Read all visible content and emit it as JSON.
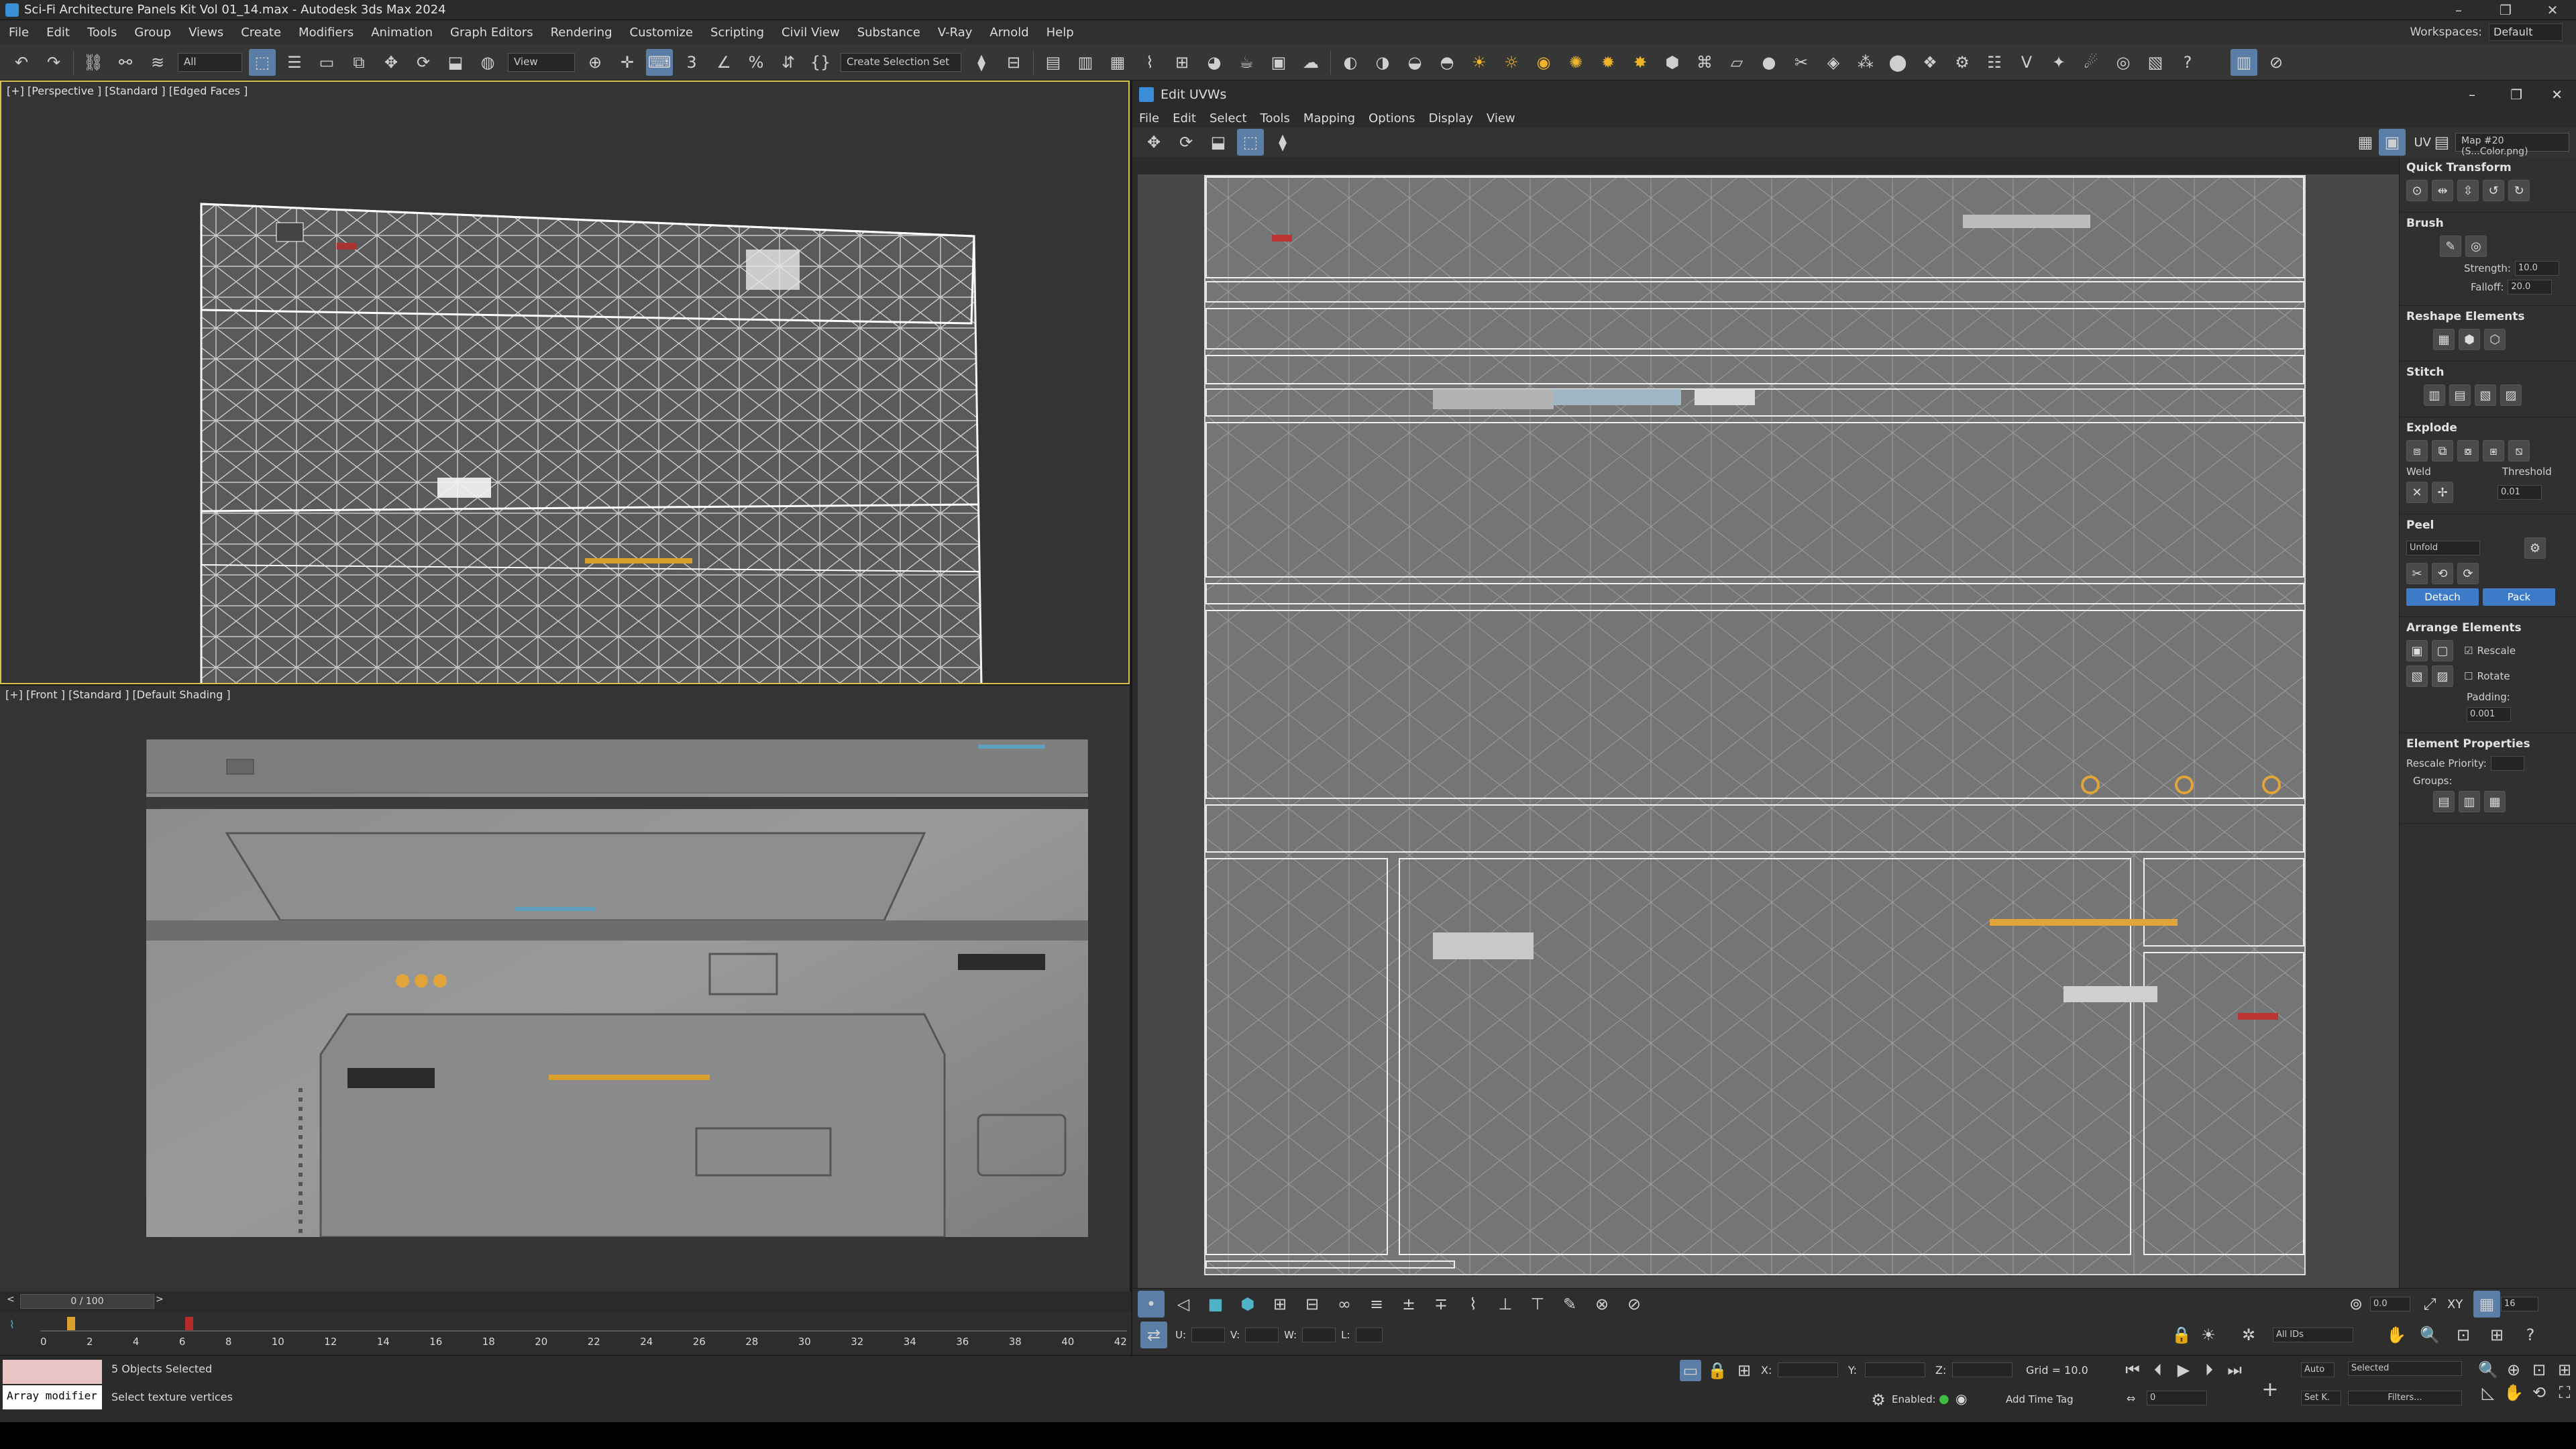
{
  "window": {
    "title": "Sci-Fi Architecture Panels Kit Vol 01_14.max - Autodesk 3ds Max 2024",
    "controls": [
      "–",
      "❐",
      "✕"
    ]
  },
  "menu": [
    "File",
    "Edit",
    "Tools",
    "Group",
    "Views",
    "Create",
    "Modifiers",
    "Animation",
    "Graph Editors",
    "Rendering",
    "Customize",
    "Scripting",
    "Civil View",
    "Substance",
    "V-Ray",
    "Arnold",
    "Help"
  ],
  "workspaces": {
    "label": "Workspaces:",
    "value": "Default"
  },
  "toolbar": {
    "filter": "All",
    "view": "View",
    "selection_set": "Create Selection Set"
  },
  "viewports": {
    "top_label": "[+] [Perspective ] [Standard ] [Edged Faces ]",
    "bottom_label": "[+] [Front ] [Standard ] [Default Shading ]"
  },
  "uv_editor": {
    "title": "Edit UVWs",
    "menu": [
      "File",
      "Edit",
      "Select",
      "Tools",
      "Mapping",
      "Options",
      "Display",
      "View"
    ],
    "uv_mode": "UV",
    "map_dropdown": "Map #20 (S...Color.png)",
    "rollouts": {
      "quick_transform": "Quick Transform",
      "brush": "Brush",
      "strength_label": "Strength:",
      "strength_value": "10.0",
      "falloff_label": "Falloff:",
      "falloff_value": "20.0",
      "reshape": "Reshape Elements",
      "stitch": "Stitch",
      "explode": "Explode",
      "weld": "Weld",
      "threshold_label": "Threshold",
      "threshold_value": "0.01",
      "peel": "Peel",
      "unfold": "Unfold",
      "detach": "Detach",
      "pack": "Pack",
      "arrange": "Arrange Elements",
      "rescale": "Rescale",
      "rotate": "Rotate",
      "padding_label": "Padding:",
      "padding_value": "0.001",
      "element_props": "Element Properties",
      "rescale_priority": "Rescale Priority:",
      "groups": "Groups:"
    },
    "bottom": {
      "u_label": "U:",
      "v_label": "V:",
      "w_label": "W:",
      "l_label": "L:",
      "angle_value": "0.0",
      "ids": "All IDs",
      "xy": "XY",
      "grid_value": "16"
    }
  },
  "timeline": {
    "frame": "0 / 100",
    "ticks": [
      "0",
      "2",
      "4",
      "6",
      "8",
      "10",
      "12",
      "14",
      "16",
      "18",
      "20",
      "22",
      "24",
      "26",
      "28",
      "30",
      "32",
      "34",
      "36",
      "38",
      "40",
      "42"
    ]
  },
  "status": {
    "modifier": "Array modifier",
    "selected": "5 Objects Selected",
    "hint": "Select texture vertices",
    "x_label": "X:",
    "y_label": "Y:",
    "z_label": "Z:",
    "grid": "Grid = 10.0",
    "enabled": "Enabled:",
    "add_time_tag": "Add Time Tag",
    "auto": "Auto",
    "selected_dd": "Selected",
    "set_k": "Set K.",
    "filters": "Filters...",
    "frame_field": "0"
  }
}
